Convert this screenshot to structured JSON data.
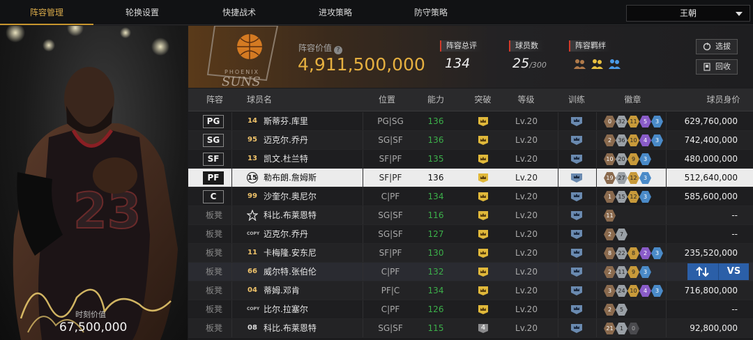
{
  "tabs": [
    "阵容管理",
    "轮换设置",
    "快捷战术",
    "进攻策略",
    "防守策略"
  ],
  "active_tab": 0,
  "team_select": "王朝",
  "player_card": {
    "value_label": "时刻价值",
    "value": "67,500,000",
    "jersey": "23"
  },
  "team_logo": {
    "city": "PHOENIX",
    "name": "SUNS"
  },
  "lineup": {
    "value_label": "阵容价值",
    "value": "4,911,500,000",
    "rating_label": "阵容总评",
    "rating": "134",
    "players_label": "球员数",
    "players": "25",
    "players_max": "/300",
    "bond_label": "阵容羁绊"
  },
  "buttons": {
    "pick": "选拔",
    "recycle": "回收",
    "vs": "VS"
  },
  "columns": [
    "阵容",
    "球员名",
    "位置",
    "能力",
    "突破",
    "等级",
    "训练",
    "徽章",
    "球员身价"
  ],
  "rows": [
    {
      "slot": "PG",
      "num": "14",
      "name": "斯蒂芬.库里",
      "pos": "PG|SG",
      "ability": "136",
      "level": "Lv.20",
      "badges": [
        "0",
        "32",
        "11",
        "5",
        "3"
      ],
      "salary": "629,760,000"
    },
    {
      "slot": "SG",
      "num": "95",
      "name": "迈克尔.乔丹",
      "pos": "SG|SF",
      "ability": "136",
      "level": "Lv.20",
      "badges": [
        "2",
        "36",
        "10",
        "4",
        "3"
      ],
      "salary": "742,400,000"
    },
    {
      "slot": "SF",
      "num": "13",
      "name": "凯文.杜兰特",
      "pos": "SF|PF",
      "ability": "135",
      "level": "Lv.20",
      "badges": [
        "10",
        "20",
        "9",
        "3"
      ],
      "salary": "480,000,000"
    },
    {
      "slot": "PF",
      "num": "15",
      "name": "勒布朗.詹姆斯",
      "pos": "SF|PF",
      "ability": "136",
      "level": "Lv.20",
      "badges": [
        "19",
        "27",
        "12",
        "3"
      ],
      "salary": "512,640,000"
    },
    {
      "slot": "C",
      "num": "99",
      "name": "沙奎尔.奥尼尔",
      "pos": "C|PF",
      "ability": "134",
      "level": "Lv.20",
      "badges": [
        "1",
        "15",
        "12",
        "3"
      ],
      "salary": "585,600,000"
    },
    {
      "slot": "板凳",
      "num": "",
      "name": "科比.布莱恩特",
      "pos": "SG|SF",
      "ability": "116",
      "level": "Lv.20",
      "badges": [
        "11"
      ],
      "salary": "--"
    },
    {
      "slot": "板凳",
      "num": "COPY",
      "name": "迈克尔.乔丹",
      "pos": "SG|SF",
      "ability": "127",
      "level": "Lv.20",
      "badges": [
        "2",
        "7"
      ],
      "salary": "--"
    },
    {
      "slot": "板凳",
      "num": "11",
      "name": "卡梅隆.安东尼",
      "pos": "SF|PF",
      "ability": "130",
      "level": "Lv.20",
      "badges": [
        "8",
        "22",
        "8",
        "2",
        "3"
      ],
      "salary": "235,520,000"
    },
    {
      "slot": "板凳",
      "num": "66",
      "name": "威尔特.张伯伦",
      "pos": "C|PF",
      "ability": "132",
      "level": "Lv.20",
      "badges": [
        "2",
        "11",
        "9",
        "3"
      ],
      "salary": ""
    },
    {
      "slot": "板凳",
      "num": "04",
      "name": "蒂姆.邓肯",
      "pos": "PF|C",
      "ability": "134",
      "level": "Lv.20",
      "badges": [
        "3",
        "24",
        "10",
        "4",
        "3"
      ],
      "salary": "716,800,000"
    },
    {
      "slot": "板凳",
      "num": "COPY",
      "name": "比尔.拉塞尔",
      "pos": "C|PF",
      "ability": "126",
      "level": "Lv.20",
      "badges": [
        "2",
        "5"
      ],
      "salary": "--"
    },
    {
      "slot": "板凳",
      "num": "08",
      "name": "科比.布莱恩特",
      "pos": "SG|SF",
      "ability": "115",
      "breakthrough": "4",
      "level": "Lv.20",
      "badges": [
        "21",
        "1",
        "0"
      ],
      "salary": "92,800,000"
    }
  ],
  "colors": {
    "gold": "#e6b040",
    "accent_red": "#d23a2a",
    "ability_green": "#3cb04a",
    "vs_blue": "#2b5fa8"
  }
}
